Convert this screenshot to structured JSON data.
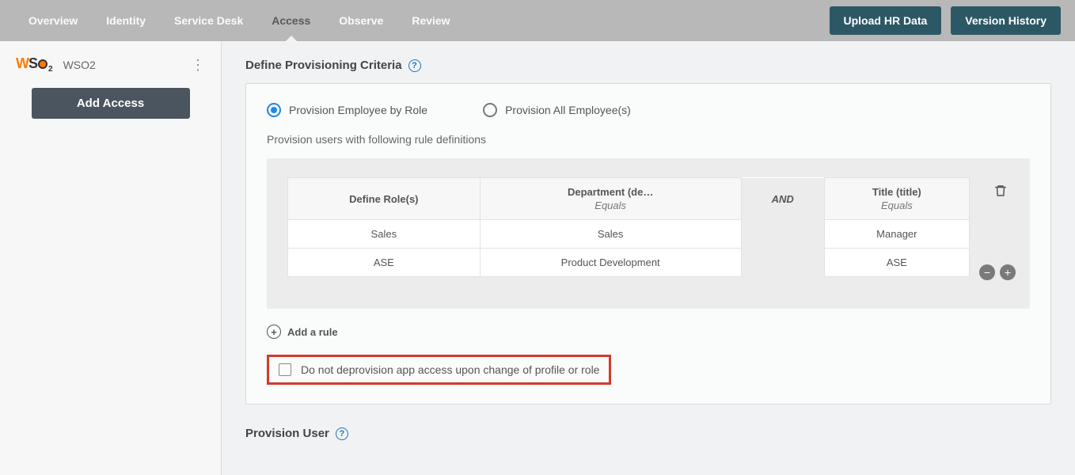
{
  "nav": {
    "tabs": [
      "Overview",
      "Identity",
      "Service Desk",
      "Access",
      "Observe",
      "Review"
    ],
    "active_index": 3,
    "upload_btn": "Upload HR Data",
    "version_btn": "Version History"
  },
  "sidebar": {
    "app_name": "WSO2",
    "add_access_btn": "Add Access"
  },
  "criteria": {
    "title": "Define Provisioning Criteria",
    "radio_by_role": "Provision Employee by Role",
    "radio_all": "Provision All Employee(s)",
    "selected_radio": "by_role",
    "hint": "Provision users with following rule definitions",
    "table": {
      "col_role": "Define Role(s)",
      "col_dept": "Department (de…",
      "col_title": "Title (title)",
      "equals": "Equals",
      "and": "AND",
      "rows": [
        {
          "role": "Sales",
          "dept": "Sales",
          "title": "Manager"
        },
        {
          "role": "ASE",
          "dept": "Product Development",
          "title": "ASE"
        }
      ]
    },
    "add_rule": "Add a rule",
    "checkbox_label": "Do not deprovision app access upon change of profile or role"
  },
  "provision_user": {
    "title": "Provision User"
  }
}
